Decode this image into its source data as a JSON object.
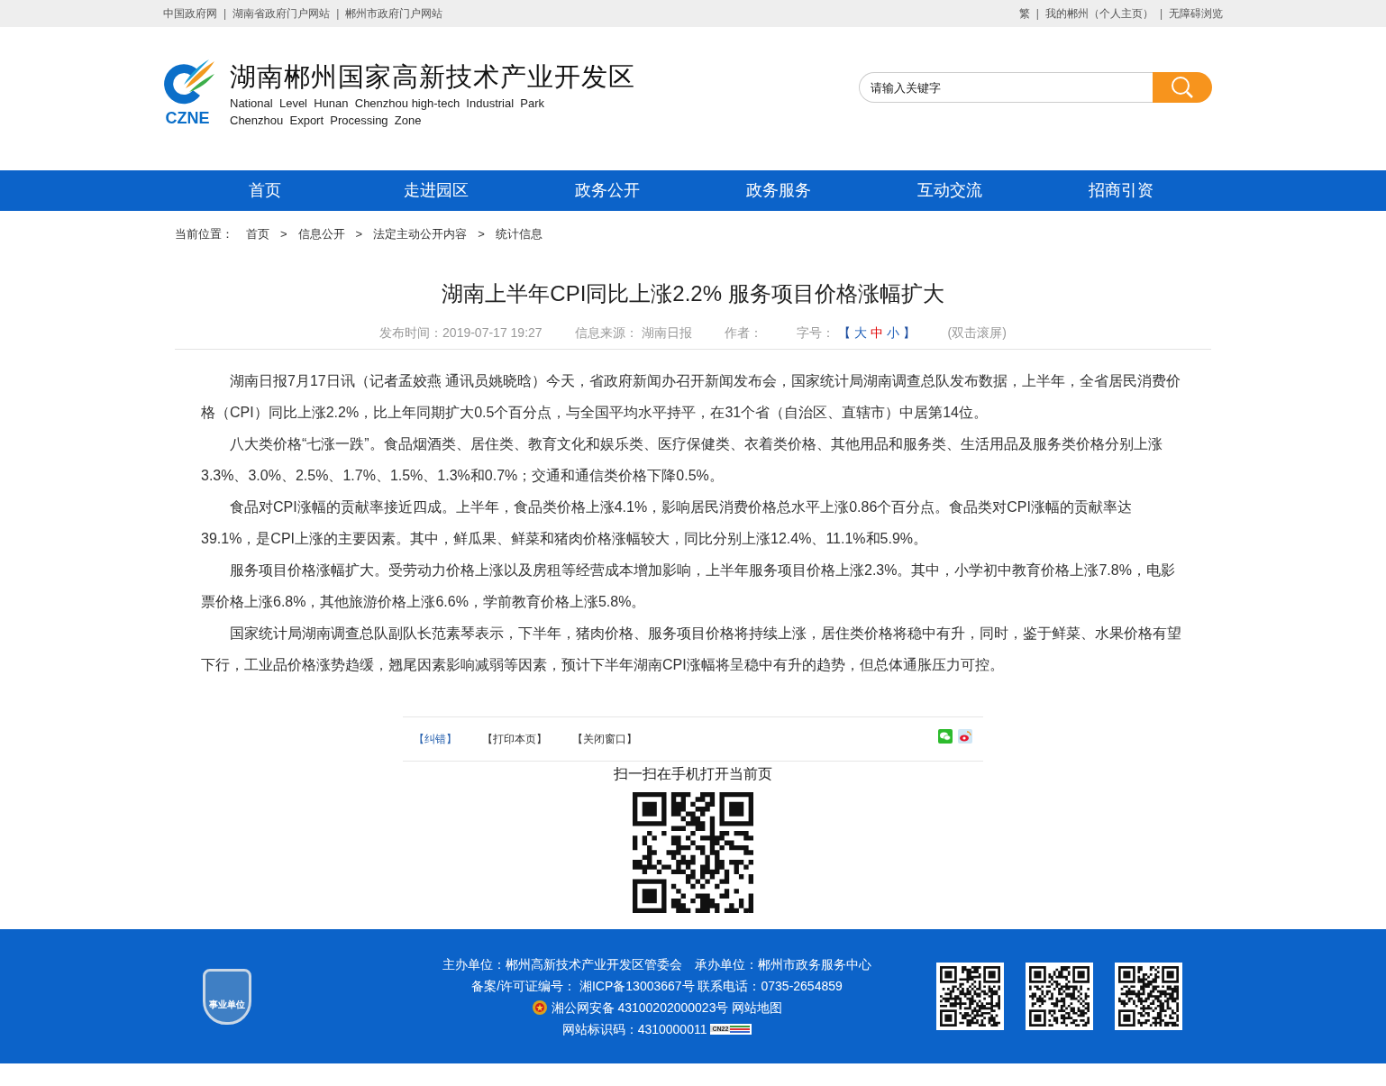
{
  "top_bar": {
    "left_links": [
      "中国政府网",
      "湖南省政府门户网站",
      "郴州市政府门户网站"
    ],
    "right_links": [
      "繁",
      "我的郴州（个人主页）",
      "无障碍浏览"
    ],
    "separator": "|"
  },
  "header": {
    "logo_text": "CZNE",
    "title": "湖南郴州国家高新技术产业开发区",
    "subtitle_lines": [
      "National  Level  Hunan  Chenzhou high-tech  Industrial  Park",
      "Chenzhou  Export  Processing  Zone"
    ],
    "search": {
      "placeholder": "请输入关键字"
    }
  },
  "nav": [
    {
      "label": "首页",
      "selected": false
    },
    {
      "label": "走进园区",
      "selected": false
    },
    {
      "label": "政务公开",
      "selected": false
    },
    {
      "label": "政务服务",
      "selected": false
    },
    {
      "label": "互动交流",
      "selected": false
    },
    {
      "label": "招商引资",
      "selected": false
    }
  ],
  "breadcrumb": {
    "label": "当前位置：",
    "items": [
      "首页",
      "信息公开",
      "法定主动公开内容",
      "统计信息"
    ],
    "separator": ">"
  },
  "article": {
    "title": "湖南上半年CPI同比上涨2.2% 服务项目价格涨幅扩大",
    "meta": {
      "date": "发布时间：2019-07-17 19:27",
      "source_label": "信息来源：",
      "source": "湖南日报",
      "author_label": "作者：",
      "font_label": "字号：",
      "font_open": "【",
      "font_close": "】",
      "font_sizes": [
        {
          "label": "大",
          "selected": false
        },
        {
          "label": "中",
          "selected": true
        },
        {
          "label": "小",
          "selected": false
        }
      ],
      "scroll_hint": "(双击滚屏)"
    },
    "paragraphs": [
      "湖南日报7月17日讯（记者孟姣燕 通讯员姚晓晗）今天，省政府新闻办召开新闻发布会，国家统计局湖南调查总队发布数据，上半年，全省居民消费价格（CPI）同比上涨2.2%，比上年同期扩大0.5个百分点，与全国平均水平持平，在31个省（自治区、直辖市）中居第14位。",
      "八大类价格“七涨一跌”。食品烟酒类、居住类、教育文化和娱乐类、医疗保健类、衣着类价格、其他用品和服务类、生活用品及服务类价格分别上涨3.3%、3.0%、2.5%、1.7%、1.5%、1.3%和0.7%；交通和通信类价格下降0.5%。",
      "食品对CPI涨幅的贡献率接近四成。上半年，食品类价格上涨4.1%，影响居民消费价格总水平上涨0.86个百分点。食品类对CPI涨幅的贡献率达39.1%，是CPI上涨的主要因素。其中，鲜瓜果、鲜菜和猪肉价格涨幅较大，同比分别上涨12.4%、11.1%和5.9%。",
      "服务项目价格涨幅扩大。受劳动力价格上涨以及房租等经营成本增加影响，上半年服务项目价格上涨2.3%。其中，小学初中教育价格上涨7.8%，电影票价格上涨6.8%，其他旅游价格上涨6.6%，学前教育价格上涨5.8%。",
      "国家统计局湖南调查总队副队长范素琴表示，下半年，猪肉价格、服务项目价格将持续上涨，居住类价格将稳中有升，同时，鉴于鲜菜、水果价格有望下行，工业品价格涨势趋缓，翘尾因素影响减弱等因素，预计下半年湖南CPI涨幅将呈稳中有升的趋势，但总体通胀压力可控。"
    ],
    "actions": [
      "【纠错】",
      "【打印本页】",
      "【关闭窗口】"
    ],
    "qr_caption": "扫一扫在手机打开当前页"
  },
  "footer": {
    "badge_text": "事业单位",
    "lines": [
      "主办单位：郴州高新技术产业开发区管委会　承办单位：郴州市政务服务中心",
      "备案/许可证编号： 湘ICP备13003667号 联系电话：0735-2654859"
    ],
    "police": "湘公网安备 43100202000023号",
    "sitemap": "网站地图",
    "site_code": "网站标识码：4310000011",
    "cn_badge": "CN22"
  }
}
